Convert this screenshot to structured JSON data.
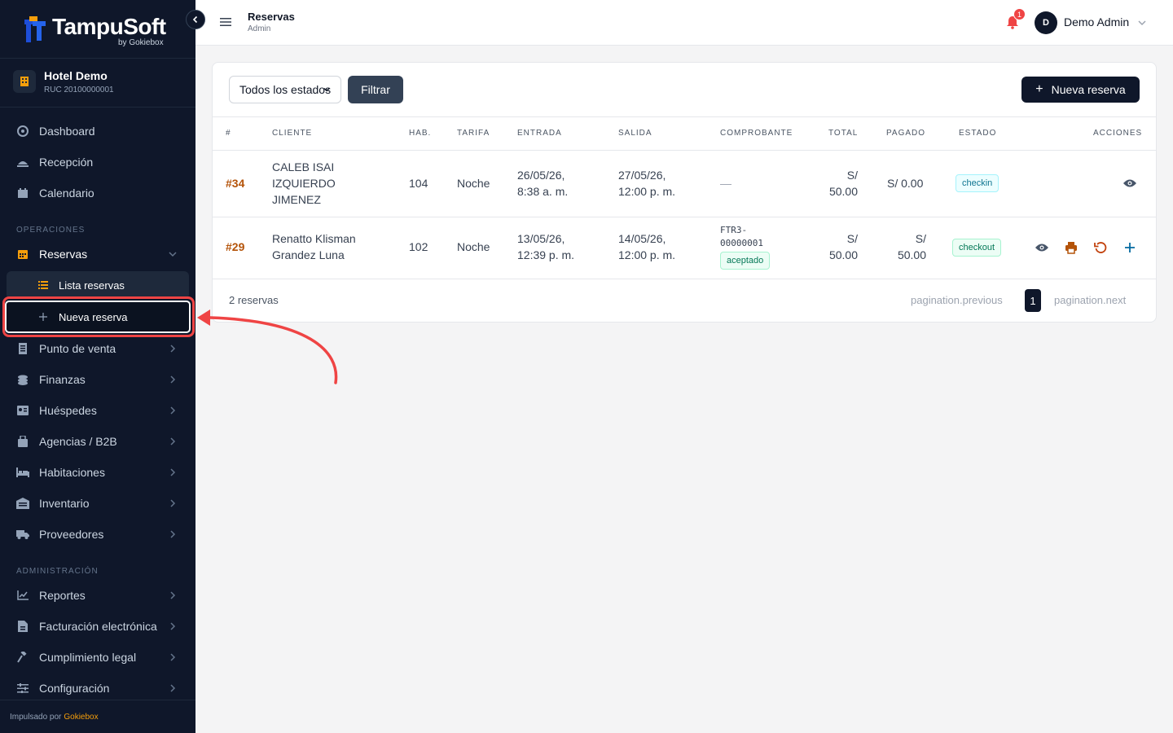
{
  "brand": {
    "name": "TampuSoft",
    "sub": "by Gokiebox"
  },
  "hotel": {
    "name": "Hotel Demo",
    "ruc": "RUC 20100000001"
  },
  "nav": {
    "main": [
      {
        "label": "Dashboard",
        "icon": "dashboard-icon"
      },
      {
        "label": "Recepción",
        "icon": "reception-icon"
      },
      {
        "label": "Calendario",
        "icon": "calendar-icon"
      }
    ],
    "section_ops": "OPERACIONES",
    "reservas": {
      "label": "Reservas",
      "icon": "calendar-grid-icon"
    },
    "sub": [
      {
        "label": "Lista reservas",
        "icon": "list-icon"
      },
      {
        "label": "Nueva reserva",
        "icon": "plus-icon"
      }
    ],
    "ops": [
      {
        "label": "Punto de venta",
        "icon": "receipt-icon"
      },
      {
        "label": "Finanzas",
        "icon": "coins-icon"
      },
      {
        "label": "Huéspedes",
        "icon": "id-card-icon"
      },
      {
        "label": "Agencias / B2B",
        "icon": "briefcase-icon"
      },
      {
        "label": "Habitaciones",
        "icon": "bed-icon"
      },
      {
        "label": "Inventario",
        "icon": "warehouse-icon"
      },
      {
        "label": "Proveedores",
        "icon": "truck-icon"
      }
    ],
    "section_admin": "ADMINISTRACIÓN",
    "admin": [
      {
        "label": "Reportes",
        "icon": "chart-line-icon"
      },
      {
        "label": "Facturación electrónica",
        "icon": "invoice-icon"
      },
      {
        "label": "Cumplimiento legal",
        "icon": "gavel-icon"
      },
      {
        "label": "Configuración",
        "icon": "sliders-icon"
      }
    ],
    "footer_prefix": "Impulsado por",
    "footer_brand": "Gokiebox"
  },
  "topbar": {
    "title": "Reservas",
    "subtitle": "Admin",
    "notifications": "1",
    "avatar": "D",
    "user": "Demo Admin"
  },
  "filters": {
    "status": "Todos los estados",
    "filter_label": "Filtrar",
    "new_label": "Nueva reserva"
  },
  "table": {
    "headers": [
      "#",
      "CLIENTE",
      "HAB.",
      "TARIFA",
      "ENTRADA",
      "SALIDA",
      "COMPROBANTE",
      "TOTAL",
      "PAGADO",
      "ESTADO",
      "ACCIONES"
    ],
    "rows": [
      {
        "id": "#34",
        "client": [
          "CALEB ISAI",
          "IZQUIERDO",
          "JIMENEZ"
        ],
        "room": "104",
        "rate": "Noche",
        "in": [
          "26/05/26,",
          "8:38 a. m."
        ],
        "out": [
          "27/05/26,",
          "12:00 p. m."
        ],
        "voucher": "—",
        "total": [
          "S/",
          "50.00"
        ],
        "paid": "S/ 0.00",
        "status": "checkin"
      },
      {
        "id": "#29",
        "client": [
          "Renatto Klisman",
          "Grandez Luna"
        ],
        "room": "102",
        "rate": "Noche",
        "in": [
          "13/05/26,",
          "12:39 p. m."
        ],
        "out": [
          "14/05/26,",
          "12:00 p. m."
        ],
        "voucher": [
          "FTR3-",
          "00000001"
        ],
        "voucher_status": "aceptado",
        "total": [
          "S/",
          "50.00"
        ],
        "paid": [
          "S/",
          "50.00"
        ],
        "status": "checkout"
      }
    ]
  },
  "footer": {
    "count": "2 reservas",
    "prev": "pagination.previous",
    "page": "1",
    "next": "pagination.next"
  },
  "colors": {
    "sidebar": "#0f172a",
    "accent": "#f59e0b",
    "highlight": "#ef4444"
  }
}
